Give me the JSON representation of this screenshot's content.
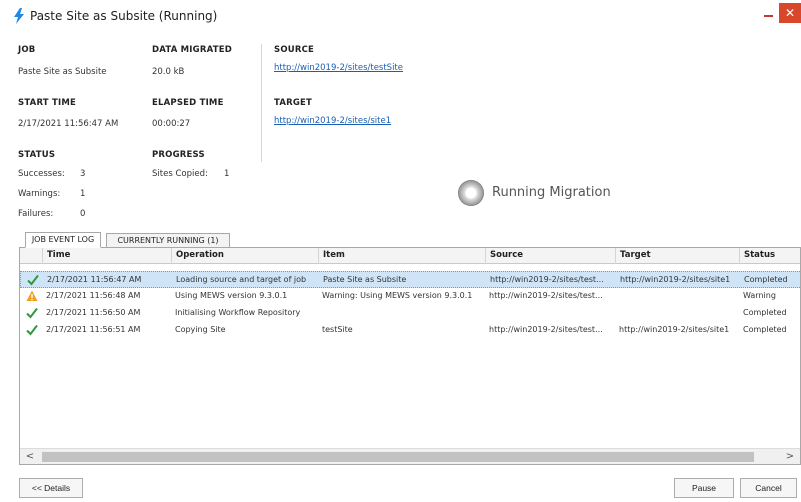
{
  "window": {
    "title": "Paste Site as Subsite (Running)",
    "close_glyph": "✕"
  },
  "summary": {
    "job_label": "JOB",
    "job_value": "Paste Site as Subsite",
    "data_migrated_label": "DATA MIGRATED",
    "data_migrated_value": "20.0 kB",
    "start_time_label": "START TIME",
    "start_time_value": "2/17/2021 11:56:47 AM",
    "elapsed_time_label": "ELAPSED TIME",
    "elapsed_time_value": "00:00:27",
    "status_label": "STATUS",
    "successes_label": "Successes:",
    "successes_value": "3",
    "warnings_label": "Warnings:",
    "warnings_value": "1",
    "failures_label": "Failures:",
    "failures_value": "0",
    "progress_label": "PROGRESS",
    "sites_copied_label": "Sites Copied:",
    "sites_copied_value": "1",
    "source_label": "SOURCE",
    "source_url": "http://win2019-2/sites/testSite",
    "target_label": "TARGET",
    "target_url": "http://win2019-2/sites/site1"
  },
  "running_status": "Running Migration",
  "tabs": [
    {
      "label": "JOB EVENT LOG",
      "active": true
    },
    {
      "label": "CURRENTLY RUNNING (1)",
      "active": false
    }
  ],
  "log": {
    "columns": [
      "Time",
      "Operation",
      "Item",
      "Source",
      "Target",
      "Status"
    ],
    "rows": [
      {
        "icon": "check-icon",
        "time": "2/17/2021 11:56:47 AM",
        "operation": "Loading source and target of job",
        "item": "Paste Site as Subsite",
        "source": "http://win2019-2/sites/test...",
        "target": "http://win2019-2/sites/site1",
        "status": "Completed",
        "selected": true
      },
      {
        "icon": "warning-icon",
        "time": "2/17/2021 11:56:48 AM",
        "operation": "Using MEWS version 9.3.0.1",
        "item": "Warning: Using MEWS version 9.3.0.1",
        "source": "http://win2019-2/sites/test...",
        "target": "",
        "status": "Warning",
        "selected": false
      },
      {
        "icon": "check-icon",
        "time": "2/17/2021 11:56:50 AM",
        "operation": "Initialising Workflow Repository",
        "item": "",
        "source": "",
        "target": "",
        "status": "Completed",
        "selected": false
      },
      {
        "icon": "check-icon",
        "time": "2/17/2021 11:56:51 AM",
        "operation": "Copying Site",
        "item": "testSite",
        "source": "http://win2019-2/sites/test...",
        "target": "http://win2019-2/sites/site1",
        "status": "Completed",
        "selected": false
      }
    ]
  },
  "scroll": {
    "left_glyph": "<",
    "right_glyph": ">"
  },
  "buttons": {
    "details": "<< Details",
    "pause": "Pause",
    "cancel": "Cancel"
  },
  "colors": {
    "accent": "#1a5fb4",
    "success": "#2e9a3c",
    "warning": "#f0a020",
    "close": "#d9472b",
    "selected_row": "#cfe4f7"
  }
}
